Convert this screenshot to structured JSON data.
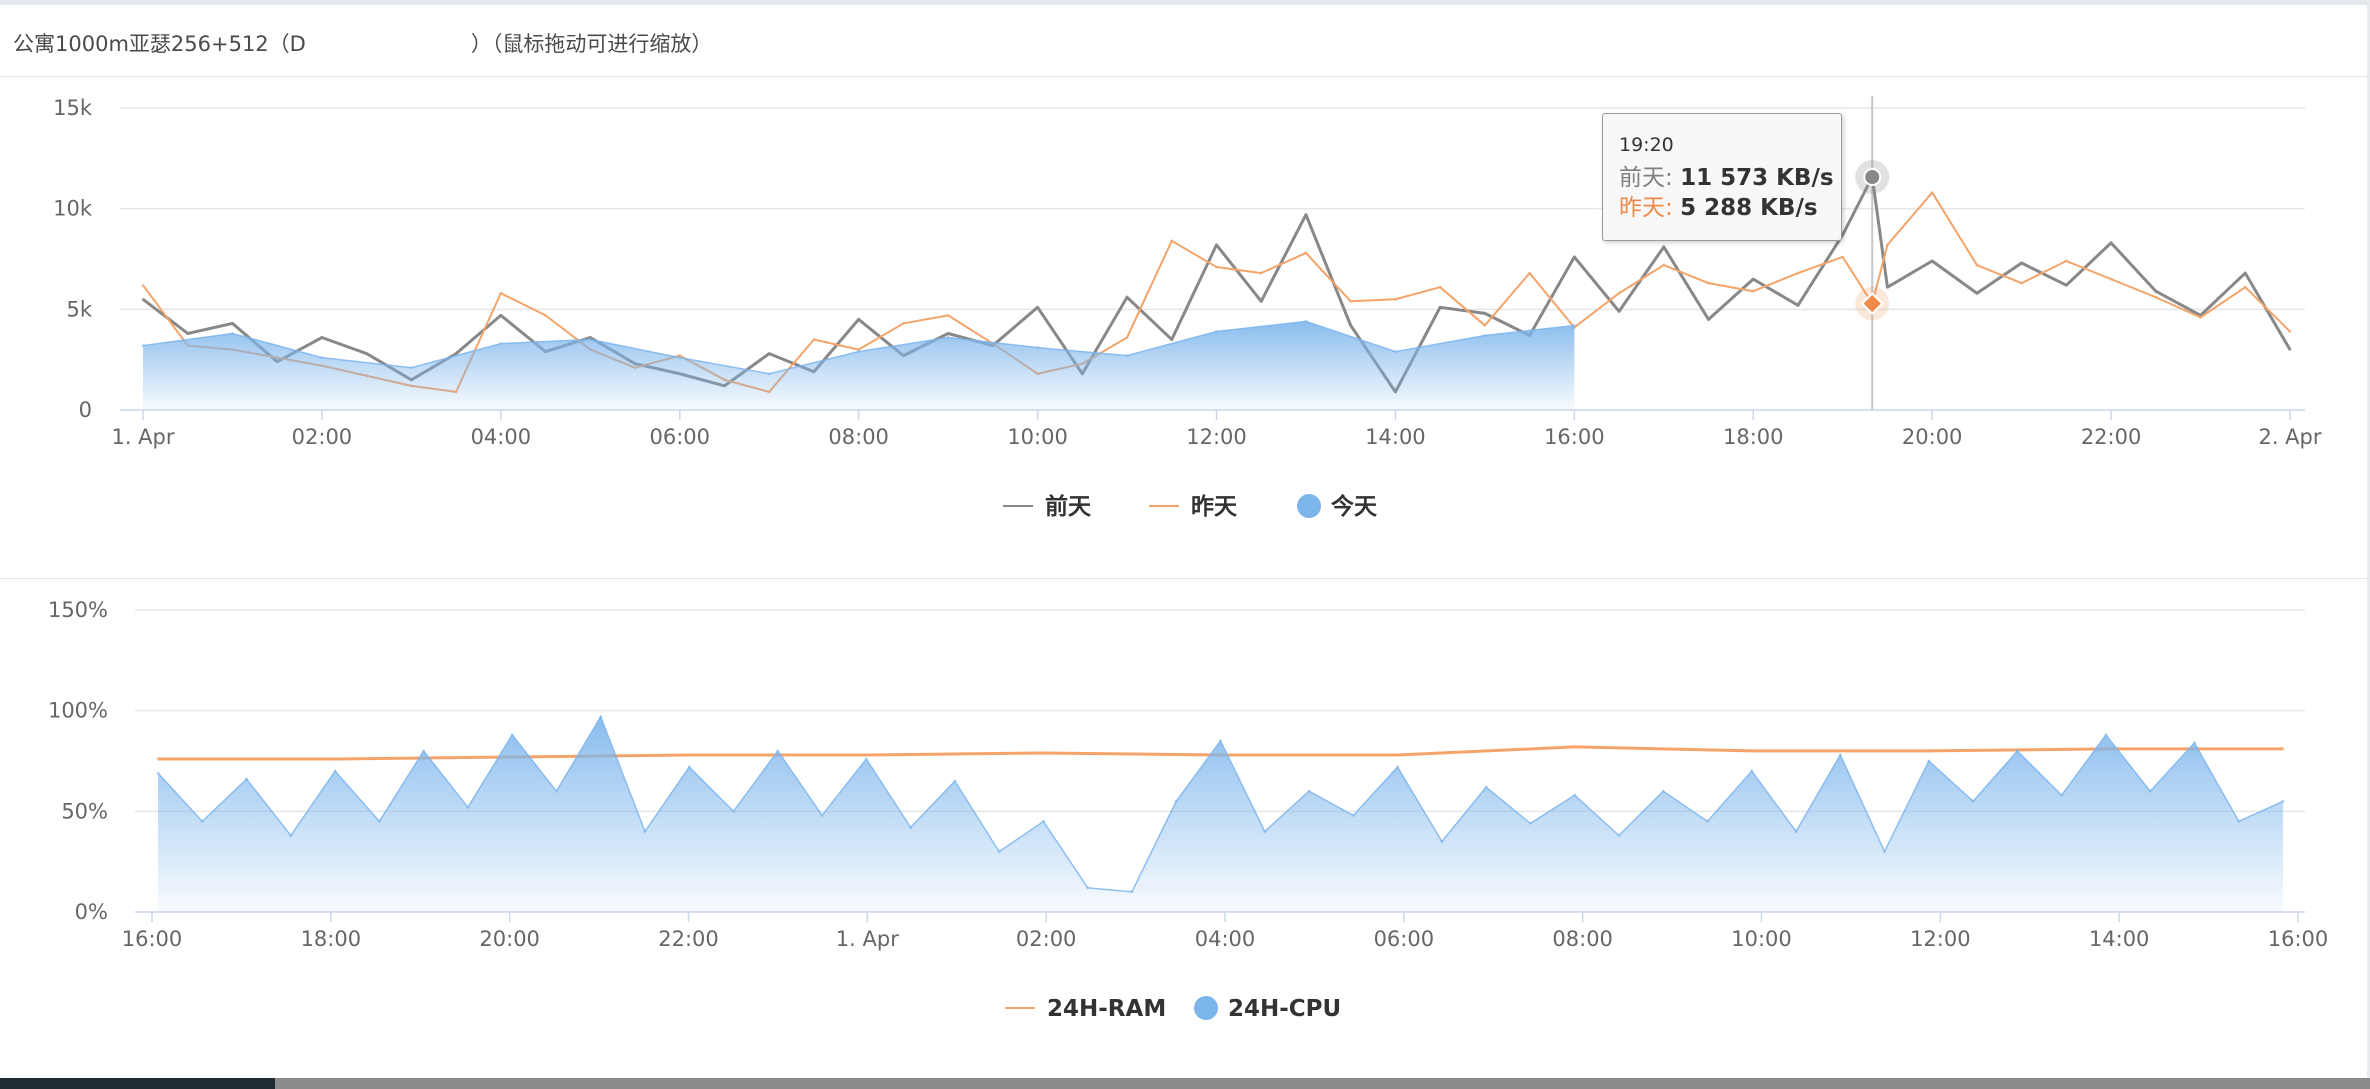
{
  "panel": {
    "title_prefix": "公寓1000m亚瑟256+512（D",
    "title_suffix": "）（鼠标拖动可进行缩放）"
  },
  "tooltip": {
    "time": "19:20",
    "rows": [
      {
        "name": "前天",
        "value": "11 573 KB/s",
        "color": "#808080"
      },
      {
        "name": "昨天",
        "value": "5 288 KB/s",
        "color": "#f08a4b"
      }
    ]
  },
  "colors": {
    "gray_series": "#888888",
    "orange_series": "#f4a469",
    "blue_series": "#7cb5ec",
    "grid": "#e6e6e6",
    "crosshair": "#c0c8d0"
  },
  "chart_data": [
    {
      "type": "line",
      "x_unit": "time (1. Apr 00:00 – 2. Apr 00:00)",
      "x_ticks": [
        "1. Apr",
        "02:00",
        "04:00",
        "06:00",
        "08:00",
        "10:00",
        "12:00",
        "14:00",
        "16:00",
        "18:00",
        "20:00",
        "22:00",
        "2. Apr"
      ],
      "y_ticks": [
        "0",
        "5k",
        "10k",
        "15k"
      ],
      "ylim": [
        0,
        15000
      ],
      "grid": true,
      "legend_position": "bottom-center",
      "crosshair_hour": 19.33,
      "series": [
        {
          "name": "前天",
          "style": "line",
          "color": "#888888",
          "x_hours": [
            0.0,
            0.5,
            1.0,
            1.5,
            2.0,
            2.5,
            3.0,
            3.5,
            4.0,
            4.5,
            5.0,
            5.5,
            6.0,
            6.5,
            7.0,
            7.5,
            8.0,
            8.5,
            9.0,
            9.5,
            10.0,
            10.5,
            11.0,
            11.5,
            12.0,
            12.5,
            13.0,
            13.5,
            14.0,
            14.5,
            15.0,
            15.5,
            16.0,
            16.5,
            17.0,
            17.5,
            18.0,
            18.5,
            19.0,
            19.33,
            19.5,
            20.0,
            20.5,
            21.0,
            21.5,
            22.0,
            22.5,
            23.0,
            23.5,
            24.0
          ],
          "values": [
            5500,
            3800,
            4300,
            2400,
            3600,
            2800,
            1500,
            2800,
            4700,
            2900,
            3600,
            2300,
            1800,
            1200,
            2800,
            1900,
            4500,
            2700,
            3800,
            3200,
            5100,
            1800,
            5600,
            3500,
            8200,
            5400,
            9700,
            4200,
            900,
            5100,
            4800,
            3700,
            7600,
            4900,
            8100,
            4500,
            6500,
            5200,
            8700,
            11573,
            6100,
            7400,
            5800,
            7300,
            6200,
            8300,
            5900,
            4700,
            6800,
            3000
          ]
        },
        {
          "name": "昨天",
          "style": "line",
          "color": "#f4a469",
          "x_hours": [
            0.0,
            0.5,
            1.0,
            1.5,
            2.0,
            2.5,
            3.0,
            3.5,
            4.0,
            4.5,
            5.0,
            5.5,
            6.0,
            6.5,
            7.0,
            7.5,
            8.0,
            8.5,
            9.0,
            9.5,
            10.0,
            10.5,
            11.0,
            11.5,
            12.0,
            12.5,
            13.0,
            13.5,
            14.0,
            14.5,
            15.0,
            15.5,
            16.0,
            16.5,
            17.0,
            17.5,
            18.0,
            18.5,
            19.0,
            19.33,
            19.5,
            20.0,
            20.5,
            21.0,
            21.5,
            22.0,
            22.5,
            23.0,
            23.5,
            24.0
          ],
          "values": [
            6200,
            3200,
            3000,
            2600,
            2200,
            1700,
            1200,
            900,
            5800,
            4700,
            3000,
            2100,
            2700,
            1500,
            900,
            3500,
            3000,
            4300,
            4700,
            3300,
            1800,
            2300,
            3600,
            8400,
            7100,
            6800,
            7800,
            5400,
            5500,
            6100,
            4200,
            6800,
            4100,
            5800,
            7200,
            6300,
            5900,
            6800,
            7600,
            5288,
            8200,
            10800,
            7200,
            6300,
            7400,
            6500,
            5600,
            4600,
            6100,
            3900
          ]
        },
        {
          "name": "今天",
          "style": "area",
          "color": "#7cb5ec",
          "x_hours": [
            0.0,
            1.0,
            2.0,
            3.0,
            4.0,
            5.0,
            6.0,
            7.0,
            8.0,
            9.0,
            10.0,
            11.0,
            12.0,
            13.0,
            14.0,
            15.0,
            16.0
          ],
          "values": [
            3200,
            3800,
            2600,
            2100,
            3300,
            3500,
            2600,
            1800,
            2900,
            3600,
            3100,
            2700,
            3900,
            4400,
            2900,
            3700,
            4200
          ]
        }
      ]
    },
    {
      "type": "area",
      "x_ticks": [
        "16:00",
        "18:00",
        "20:00",
        "22:00",
        "1. Apr",
        "02:00",
        "04:00",
        "06:00",
        "08:00",
        "10:00",
        "12:00",
        "14:00",
        "16:00"
      ],
      "y_ticks": [
        "0%",
        "50%",
        "100%",
        "150%"
      ],
      "ylim": [
        0,
        150
      ],
      "grid": true,
      "legend_position": "bottom-center",
      "series": [
        {
          "name": "24H-RAM",
          "style": "line",
          "color": "#f4a469",
          "x_hours": [
            0.0,
            2.0,
            4.0,
            6.0,
            8.0,
            10.0,
            12.0,
            14.0,
            16.0,
            18.0,
            20.0,
            22.0,
            24.0
          ],
          "values": [
            76,
            76,
            77,
            78,
            78,
            79,
            78,
            78,
            82,
            80,
            80,
            81,
            81
          ]
        },
        {
          "name": "24H-CPU",
          "style": "area",
          "color": "#7cb5ec",
          "x_hours": [
            0.0,
            0.5,
            1.0,
            1.5,
            2.0,
            2.5,
            3.0,
            3.5,
            4.0,
            4.5,
            5.0,
            5.5,
            6.0,
            6.5,
            7.0,
            7.5,
            8.0,
            8.5,
            9.0,
            9.5,
            10.0,
            10.5,
            11.0,
            11.5,
            12.0,
            12.5,
            13.0,
            13.5,
            14.0,
            14.5,
            15.0,
            15.5,
            16.0,
            16.5,
            17.0,
            17.5,
            18.0,
            18.5,
            19.0,
            19.5,
            20.0,
            20.5,
            21.0,
            21.5,
            22.0,
            22.5,
            23.0,
            23.5,
            24.0
          ],
          "values": [
            69,
            45,
            66,
            38,
            70,
            45,
            80,
            52,
            88,
            60,
            97,
            40,
            72,
            50,
            80,
            48,
            76,
            42,
            65,
            30,
            45,
            12,
            10,
            55,
            85,
            40,
            60,
            48,
            72,
            35,
            62,
            44,
            58,
            38,
            60,
            45,
            70,
            40,
            78,
            30,
            75,
            55,
            80,
            58,
            88,
            60,
            84,
            45,
            55
          ]
        }
      ]
    }
  ]
}
